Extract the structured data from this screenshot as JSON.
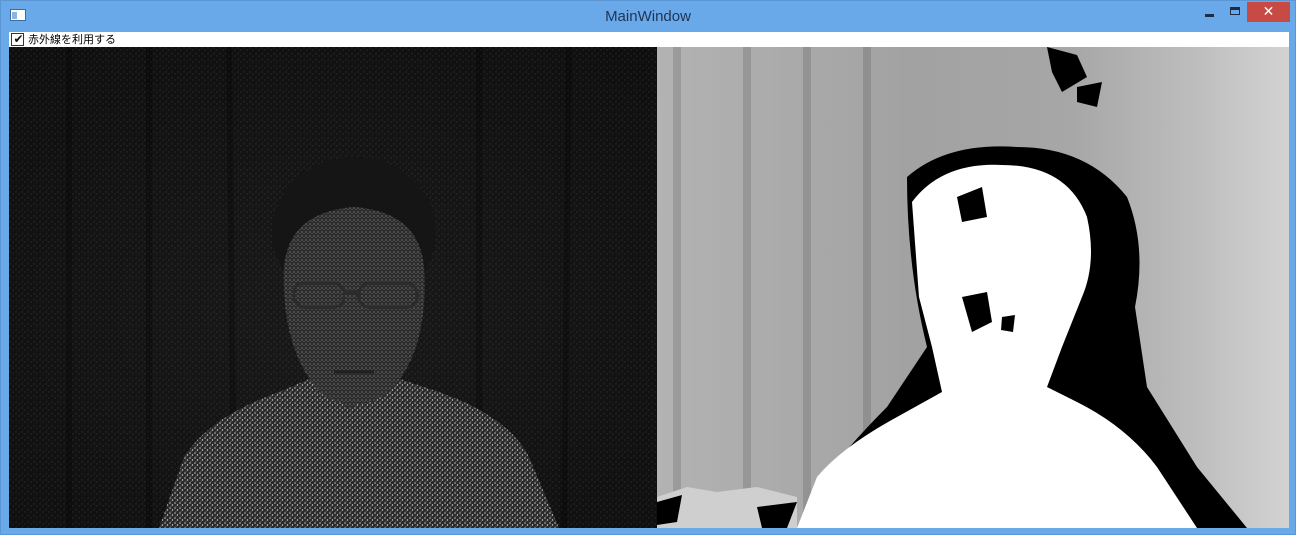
{
  "window": {
    "title": "MainWindow",
    "icon": "app-window-icon",
    "controls": {
      "minimize": "minimize-icon",
      "maximize": "maximize-icon",
      "close": "close-icon"
    }
  },
  "toolbar": {
    "use_infrared": {
      "label": "赤外線を利用する",
      "checked": true
    }
  },
  "views": {
    "left": {
      "kind": "infrared-camera-feed"
    },
    "right": {
      "kind": "depth-map-feed"
    }
  },
  "colors": {
    "titlebar": "#6aa9e9",
    "close_button": "#c74b44",
    "ir_background": "#0e0e0e",
    "depth_foreground": "#ffffff",
    "depth_shadow": "#000000"
  }
}
